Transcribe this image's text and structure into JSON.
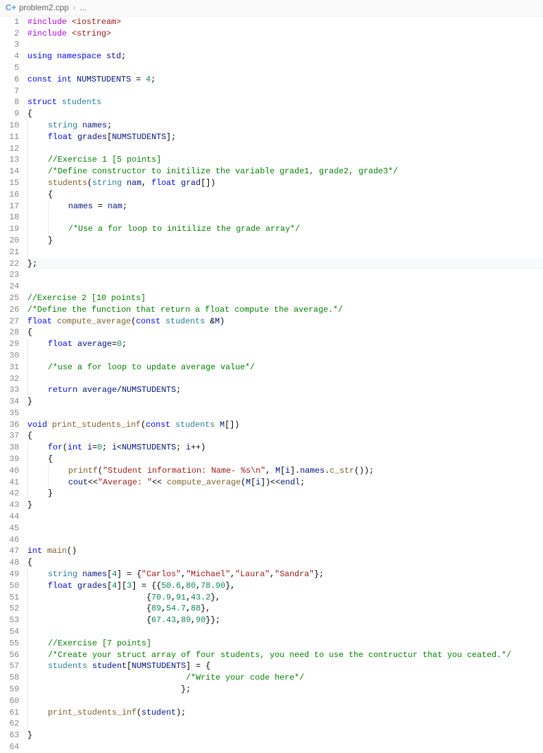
{
  "breadcrumb": {
    "icon": "C+",
    "filename": "problem2.cpp",
    "ellipsis": "..."
  },
  "code": {
    "lines": [
      {
        "n": 1,
        "hl": false,
        "indent": 0,
        "tokens": [
          [
            "mac",
            "#include "
          ],
          [
            "inc",
            "<iostream>"
          ]
        ]
      },
      {
        "n": 2,
        "hl": false,
        "indent": 0,
        "tokens": [
          [
            "mac",
            "#include "
          ],
          [
            "inc",
            "<string>"
          ]
        ]
      },
      {
        "n": 3,
        "hl": false,
        "indent": 0,
        "tokens": []
      },
      {
        "n": 4,
        "hl": false,
        "indent": 0,
        "tokens": [
          [
            "kw",
            "using "
          ],
          [
            "kw",
            "namespace "
          ],
          [
            "var",
            "std"
          ],
          [
            "op",
            ";"
          ]
        ]
      },
      {
        "n": 5,
        "hl": false,
        "indent": 0,
        "tokens": []
      },
      {
        "n": 6,
        "hl": false,
        "indent": 0,
        "tokens": [
          [
            "kw",
            "const "
          ],
          [
            "kw",
            "int "
          ],
          [
            "var",
            "NUMSTUDENTS"
          ],
          [
            "op",
            " = "
          ],
          [
            "num",
            "4"
          ],
          [
            "op",
            ";"
          ]
        ]
      },
      {
        "n": 7,
        "hl": false,
        "indent": 0,
        "tokens": []
      },
      {
        "n": 8,
        "hl": false,
        "indent": 0,
        "tokens": [
          [
            "kw",
            "struct "
          ],
          [
            "cls",
            "students"
          ]
        ]
      },
      {
        "n": 9,
        "hl": false,
        "indent": 0,
        "tokens": [
          [
            "op",
            "{"
          ]
        ]
      },
      {
        "n": 10,
        "hl": false,
        "indent": 1,
        "tokens": [
          [
            "cls",
            "string "
          ],
          [
            "var",
            "names"
          ],
          [
            "op",
            ";"
          ]
        ]
      },
      {
        "n": 11,
        "hl": false,
        "indent": 1,
        "tokens": [
          [
            "kw",
            "float "
          ],
          [
            "var",
            "grades"
          ],
          [
            "op",
            "["
          ],
          [
            "var",
            "NUMSTUDENTS"
          ],
          [
            "op",
            "];"
          ]
        ]
      },
      {
        "n": 12,
        "hl": false,
        "indent": 1,
        "tokens": []
      },
      {
        "n": 13,
        "hl": false,
        "indent": 1,
        "tokens": [
          [
            "cmt",
            "//Exercise 1 [5 points]"
          ]
        ]
      },
      {
        "n": 14,
        "hl": false,
        "indent": 1,
        "tokens": [
          [
            "cmt",
            "/*Define constructor to initilize the variable grade1, grade2, grade3*/"
          ]
        ]
      },
      {
        "n": 15,
        "hl": false,
        "indent": 1,
        "tokens": [
          [
            "fn",
            "students"
          ],
          [
            "op",
            "("
          ],
          [
            "cls",
            "string "
          ],
          [
            "var",
            "nam"
          ],
          [
            "op",
            ", "
          ],
          [
            "kw",
            "float "
          ],
          [
            "var",
            "grad"
          ],
          [
            "op",
            "[])"
          ]
        ]
      },
      {
        "n": 16,
        "hl": false,
        "indent": 1,
        "tokens": [
          [
            "op",
            "{"
          ]
        ]
      },
      {
        "n": 17,
        "hl": false,
        "indent": 2,
        "tokens": [
          [
            "var",
            "names"
          ],
          [
            "op",
            " = "
          ],
          [
            "var",
            "nam"
          ],
          [
            "op",
            ";"
          ]
        ]
      },
      {
        "n": 18,
        "hl": false,
        "indent": 2,
        "tokens": []
      },
      {
        "n": 19,
        "hl": false,
        "indent": 2,
        "tokens": [
          [
            "cmt",
            "/*Use a for loop to initilize the grade array*/"
          ]
        ]
      },
      {
        "n": 20,
        "hl": false,
        "indent": 1,
        "tokens": [
          [
            "op",
            "}"
          ]
        ]
      },
      {
        "n": 21,
        "hl": false,
        "indent": 1,
        "tokens": []
      },
      {
        "n": 22,
        "hl": true,
        "indent": 0,
        "tokens": [
          [
            "op",
            "};"
          ]
        ]
      },
      {
        "n": 23,
        "hl": false,
        "indent": 0,
        "tokens": []
      },
      {
        "n": 24,
        "hl": false,
        "indent": 0,
        "tokens": []
      },
      {
        "n": 25,
        "hl": false,
        "indent": 0,
        "tokens": [
          [
            "cmt",
            "//Exercise 2 [10 points]"
          ]
        ]
      },
      {
        "n": 26,
        "hl": false,
        "indent": 0,
        "tokens": [
          [
            "cmt",
            "/*Define the function that return a float compute the average.*/"
          ]
        ]
      },
      {
        "n": 27,
        "hl": false,
        "indent": 0,
        "tokens": [
          [
            "kw",
            "float "
          ],
          [
            "fn",
            "compute_average"
          ],
          [
            "op",
            "("
          ],
          [
            "kw",
            "const "
          ],
          [
            "cls",
            "students "
          ],
          [
            "op",
            "&"
          ],
          [
            "var",
            "M"
          ],
          [
            "op",
            ")"
          ]
        ]
      },
      {
        "n": 28,
        "hl": false,
        "indent": 0,
        "tokens": [
          [
            "op",
            "{"
          ]
        ]
      },
      {
        "n": 29,
        "hl": false,
        "indent": 1,
        "tokens": [
          [
            "kw",
            "float "
          ],
          [
            "var",
            "average"
          ],
          [
            "op",
            "="
          ],
          [
            "num",
            "0"
          ],
          [
            "op",
            ";"
          ]
        ]
      },
      {
        "n": 30,
        "hl": false,
        "indent": 1,
        "tokens": []
      },
      {
        "n": 31,
        "hl": false,
        "indent": 1,
        "tokens": [
          [
            "cmt",
            "/*use a for loop to update average value*/"
          ]
        ]
      },
      {
        "n": 32,
        "hl": false,
        "indent": 1,
        "tokens": []
      },
      {
        "n": 33,
        "hl": false,
        "indent": 1,
        "tokens": [
          [
            "kw",
            "return "
          ],
          [
            "var",
            "average"
          ],
          [
            "op",
            "/"
          ],
          [
            "var",
            "NUMSTUDENTS"
          ],
          [
            "op",
            ";"
          ]
        ]
      },
      {
        "n": 34,
        "hl": false,
        "indent": 0,
        "tokens": [
          [
            "op",
            "}"
          ]
        ]
      },
      {
        "n": 35,
        "hl": false,
        "indent": 0,
        "tokens": []
      },
      {
        "n": 36,
        "hl": false,
        "indent": 0,
        "tokens": [
          [
            "kw",
            "void "
          ],
          [
            "fn",
            "print_students_inf"
          ],
          [
            "op",
            "("
          ],
          [
            "kw",
            "const "
          ],
          [
            "cls",
            "students "
          ],
          [
            "var",
            "M"
          ],
          [
            "op",
            "[])"
          ]
        ]
      },
      {
        "n": 37,
        "hl": false,
        "indent": 0,
        "tokens": [
          [
            "op",
            "{"
          ]
        ]
      },
      {
        "n": 38,
        "hl": false,
        "indent": 1,
        "tokens": [
          [
            "kw",
            "for"
          ],
          [
            "op",
            "("
          ],
          [
            "kw",
            "int "
          ],
          [
            "var",
            "i"
          ],
          [
            "op",
            "="
          ],
          [
            "num",
            "0"
          ],
          [
            "op",
            "; "
          ],
          [
            "var",
            "i"
          ],
          [
            "op",
            "<"
          ],
          [
            "var",
            "NUMSTUDENTS"
          ],
          [
            "op",
            "; "
          ],
          [
            "var",
            "i"
          ],
          [
            "op",
            "++)"
          ]
        ]
      },
      {
        "n": 39,
        "hl": false,
        "indent": 1,
        "tokens": [
          [
            "op",
            "{"
          ]
        ]
      },
      {
        "n": 40,
        "hl": false,
        "indent": 2,
        "tokens": [
          [
            "fn",
            "printf"
          ],
          [
            "op",
            "("
          ],
          [
            "str",
            "\"Student information: Name- %s\\n\""
          ],
          [
            "op",
            ", "
          ],
          [
            "var",
            "M"
          ],
          [
            "op",
            "["
          ],
          [
            "var",
            "i"
          ],
          [
            "op",
            "]."
          ],
          [
            "var",
            "names"
          ],
          [
            "op",
            "."
          ],
          [
            "fn",
            "c_str"
          ],
          [
            "op",
            "());"
          ]
        ]
      },
      {
        "n": 41,
        "hl": false,
        "indent": 2,
        "tokens": [
          [
            "var",
            "cout"
          ],
          [
            "op",
            "<<"
          ],
          [
            "str",
            "\"Average: \""
          ],
          [
            "op",
            "<< "
          ],
          [
            "fn",
            "compute_average"
          ],
          [
            "op",
            "("
          ],
          [
            "var",
            "M"
          ],
          [
            "op",
            "["
          ],
          [
            "var",
            "i"
          ],
          [
            "op",
            "])<<"
          ],
          [
            "var",
            "endl"
          ],
          [
            "op",
            ";"
          ]
        ]
      },
      {
        "n": 42,
        "hl": false,
        "indent": 1,
        "tokens": [
          [
            "op",
            "}"
          ]
        ]
      },
      {
        "n": 43,
        "hl": false,
        "indent": 0,
        "tokens": [
          [
            "op",
            "}"
          ]
        ]
      },
      {
        "n": 44,
        "hl": false,
        "indent": 0,
        "tokens": []
      },
      {
        "n": 45,
        "hl": false,
        "indent": 0,
        "tokens": []
      },
      {
        "n": 46,
        "hl": false,
        "indent": 0,
        "tokens": []
      },
      {
        "n": 47,
        "hl": false,
        "indent": 0,
        "tokens": [
          [
            "kw",
            "int "
          ],
          [
            "fn",
            "main"
          ],
          [
            "op",
            "()"
          ]
        ]
      },
      {
        "n": 48,
        "hl": false,
        "indent": 0,
        "tokens": [
          [
            "op",
            "{"
          ]
        ]
      },
      {
        "n": 49,
        "hl": false,
        "indent": 1,
        "tokens": [
          [
            "cls",
            "string "
          ],
          [
            "var",
            "names"
          ],
          [
            "op",
            "["
          ],
          [
            "num",
            "4"
          ],
          [
            "op",
            "] = {"
          ],
          [
            "str",
            "\"Carlos\""
          ],
          [
            "op",
            ","
          ],
          [
            "str",
            "\"Michael\""
          ],
          [
            "op",
            ","
          ],
          [
            "str",
            "\"Laura\""
          ],
          [
            "op",
            ","
          ],
          [
            "str",
            "\"Sandra\""
          ],
          [
            "op",
            "};"
          ]
        ]
      },
      {
        "n": 50,
        "hl": false,
        "indent": 1,
        "tokens": [
          [
            "kw",
            "float "
          ],
          [
            "var",
            "grades"
          ],
          [
            "op",
            "["
          ],
          [
            "num",
            "4"
          ],
          [
            "op",
            "]["
          ],
          [
            "num",
            "3"
          ],
          [
            "op",
            "] = {{"
          ],
          [
            "num",
            "50.6"
          ],
          [
            "op",
            ","
          ],
          [
            "num",
            "80"
          ],
          [
            "op",
            ","
          ],
          [
            "num",
            "78.90"
          ],
          [
            "op",
            "},"
          ]
        ]
      },
      {
        "n": 51,
        "hl": false,
        "indent": 1,
        "pad": "                    ",
        "tokens": [
          [
            "op",
            "{"
          ],
          [
            "num",
            "70.9"
          ],
          [
            "op",
            ","
          ],
          [
            "num",
            "91"
          ],
          [
            "op",
            ","
          ],
          [
            "num",
            "43.2"
          ],
          [
            "op",
            "},"
          ]
        ]
      },
      {
        "n": 52,
        "hl": false,
        "indent": 1,
        "pad": "                    ",
        "tokens": [
          [
            "op",
            "{"
          ],
          [
            "num",
            "89"
          ],
          [
            "op",
            ","
          ],
          [
            "num",
            "54.7"
          ],
          [
            "op",
            ","
          ],
          [
            "num",
            "88"
          ],
          [
            "op",
            "},"
          ]
        ]
      },
      {
        "n": 53,
        "hl": false,
        "indent": 1,
        "pad": "                    ",
        "tokens": [
          [
            "op",
            "{"
          ],
          [
            "num",
            "67.43"
          ],
          [
            "op",
            ","
          ],
          [
            "num",
            "89"
          ],
          [
            "op",
            ","
          ],
          [
            "num",
            "90"
          ],
          [
            "op",
            "}};"
          ]
        ]
      },
      {
        "n": 54,
        "hl": false,
        "indent": 1,
        "tokens": []
      },
      {
        "n": 55,
        "hl": false,
        "indent": 1,
        "tokens": [
          [
            "cmt",
            "//Exercise [7 points]"
          ]
        ]
      },
      {
        "n": 56,
        "hl": false,
        "indent": 1,
        "tokens": [
          [
            "cmt",
            "/*Create your struct array of four students, you need to use the contructur that you ceated.*/"
          ]
        ]
      },
      {
        "n": 57,
        "hl": false,
        "indent": 1,
        "tokens": [
          [
            "cls",
            "students "
          ],
          [
            "var",
            "student"
          ],
          [
            "op",
            "["
          ],
          [
            "var",
            "NUMSTUDENTS"
          ],
          [
            "op",
            "] = {"
          ]
        ]
      },
      {
        "n": 58,
        "hl": false,
        "indent": 1,
        "pad": "                            ",
        "tokens": [
          [
            "cmt",
            "/*Write your code here*/"
          ]
        ]
      },
      {
        "n": 59,
        "hl": false,
        "indent": 1,
        "pad": "                           ",
        "tokens": [
          [
            "op",
            "};"
          ]
        ]
      },
      {
        "n": 60,
        "hl": false,
        "indent": 1,
        "tokens": []
      },
      {
        "n": 61,
        "hl": false,
        "indent": 1,
        "tokens": [
          [
            "fn",
            "print_students_inf"
          ],
          [
            "op",
            "("
          ],
          [
            "var",
            "student"
          ],
          [
            "op",
            ");"
          ]
        ]
      },
      {
        "n": 62,
        "hl": false,
        "indent": 1,
        "tokens": []
      },
      {
        "n": 63,
        "hl": false,
        "indent": 0,
        "tokens": [
          [
            "op",
            "}"
          ]
        ]
      },
      {
        "n": 64,
        "hl": false,
        "indent": 0,
        "tokens": []
      }
    ]
  }
}
